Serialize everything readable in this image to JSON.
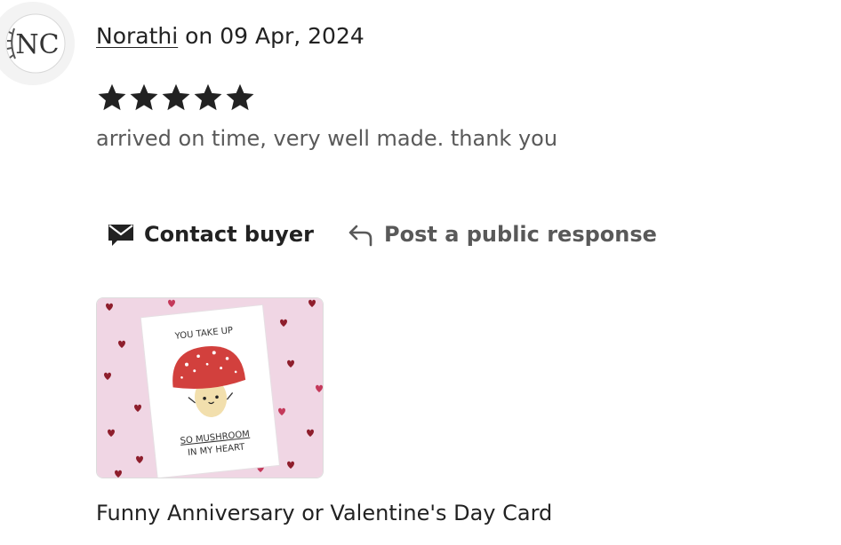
{
  "review": {
    "reviewer_name": "Norathi",
    "date_text": "on 09 Apr, 2024",
    "avatar_initials": "NC",
    "rating": 5,
    "rating_max": 5,
    "text": "arrived on time, very well made. thank you"
  },
  "actions": {
    "contact_label": "Contact buyer",
    "contact_icon": "envelope-icon",
    "post_label": "Post a public response",
    "post_icon": "reply-arrow-icon"
  },
  "listing": {
    "card_line1": "YOU TAKE UP",
    "card_line2": "SO MUSHROOM",
    "card_line3": "IN MY HEART",
    "title": "Funny Anniversary or Valentine's Day Card"
  },
  "colors": {
    "text_primary": "#222222",
    "text_secondary": "#595959",
    "star": "#222222",
    "thumb_bg": "#f0d6e4",
    "mushroom_cap": "#d2403d",
    "heart": "#8e1e2c"
  }
}
